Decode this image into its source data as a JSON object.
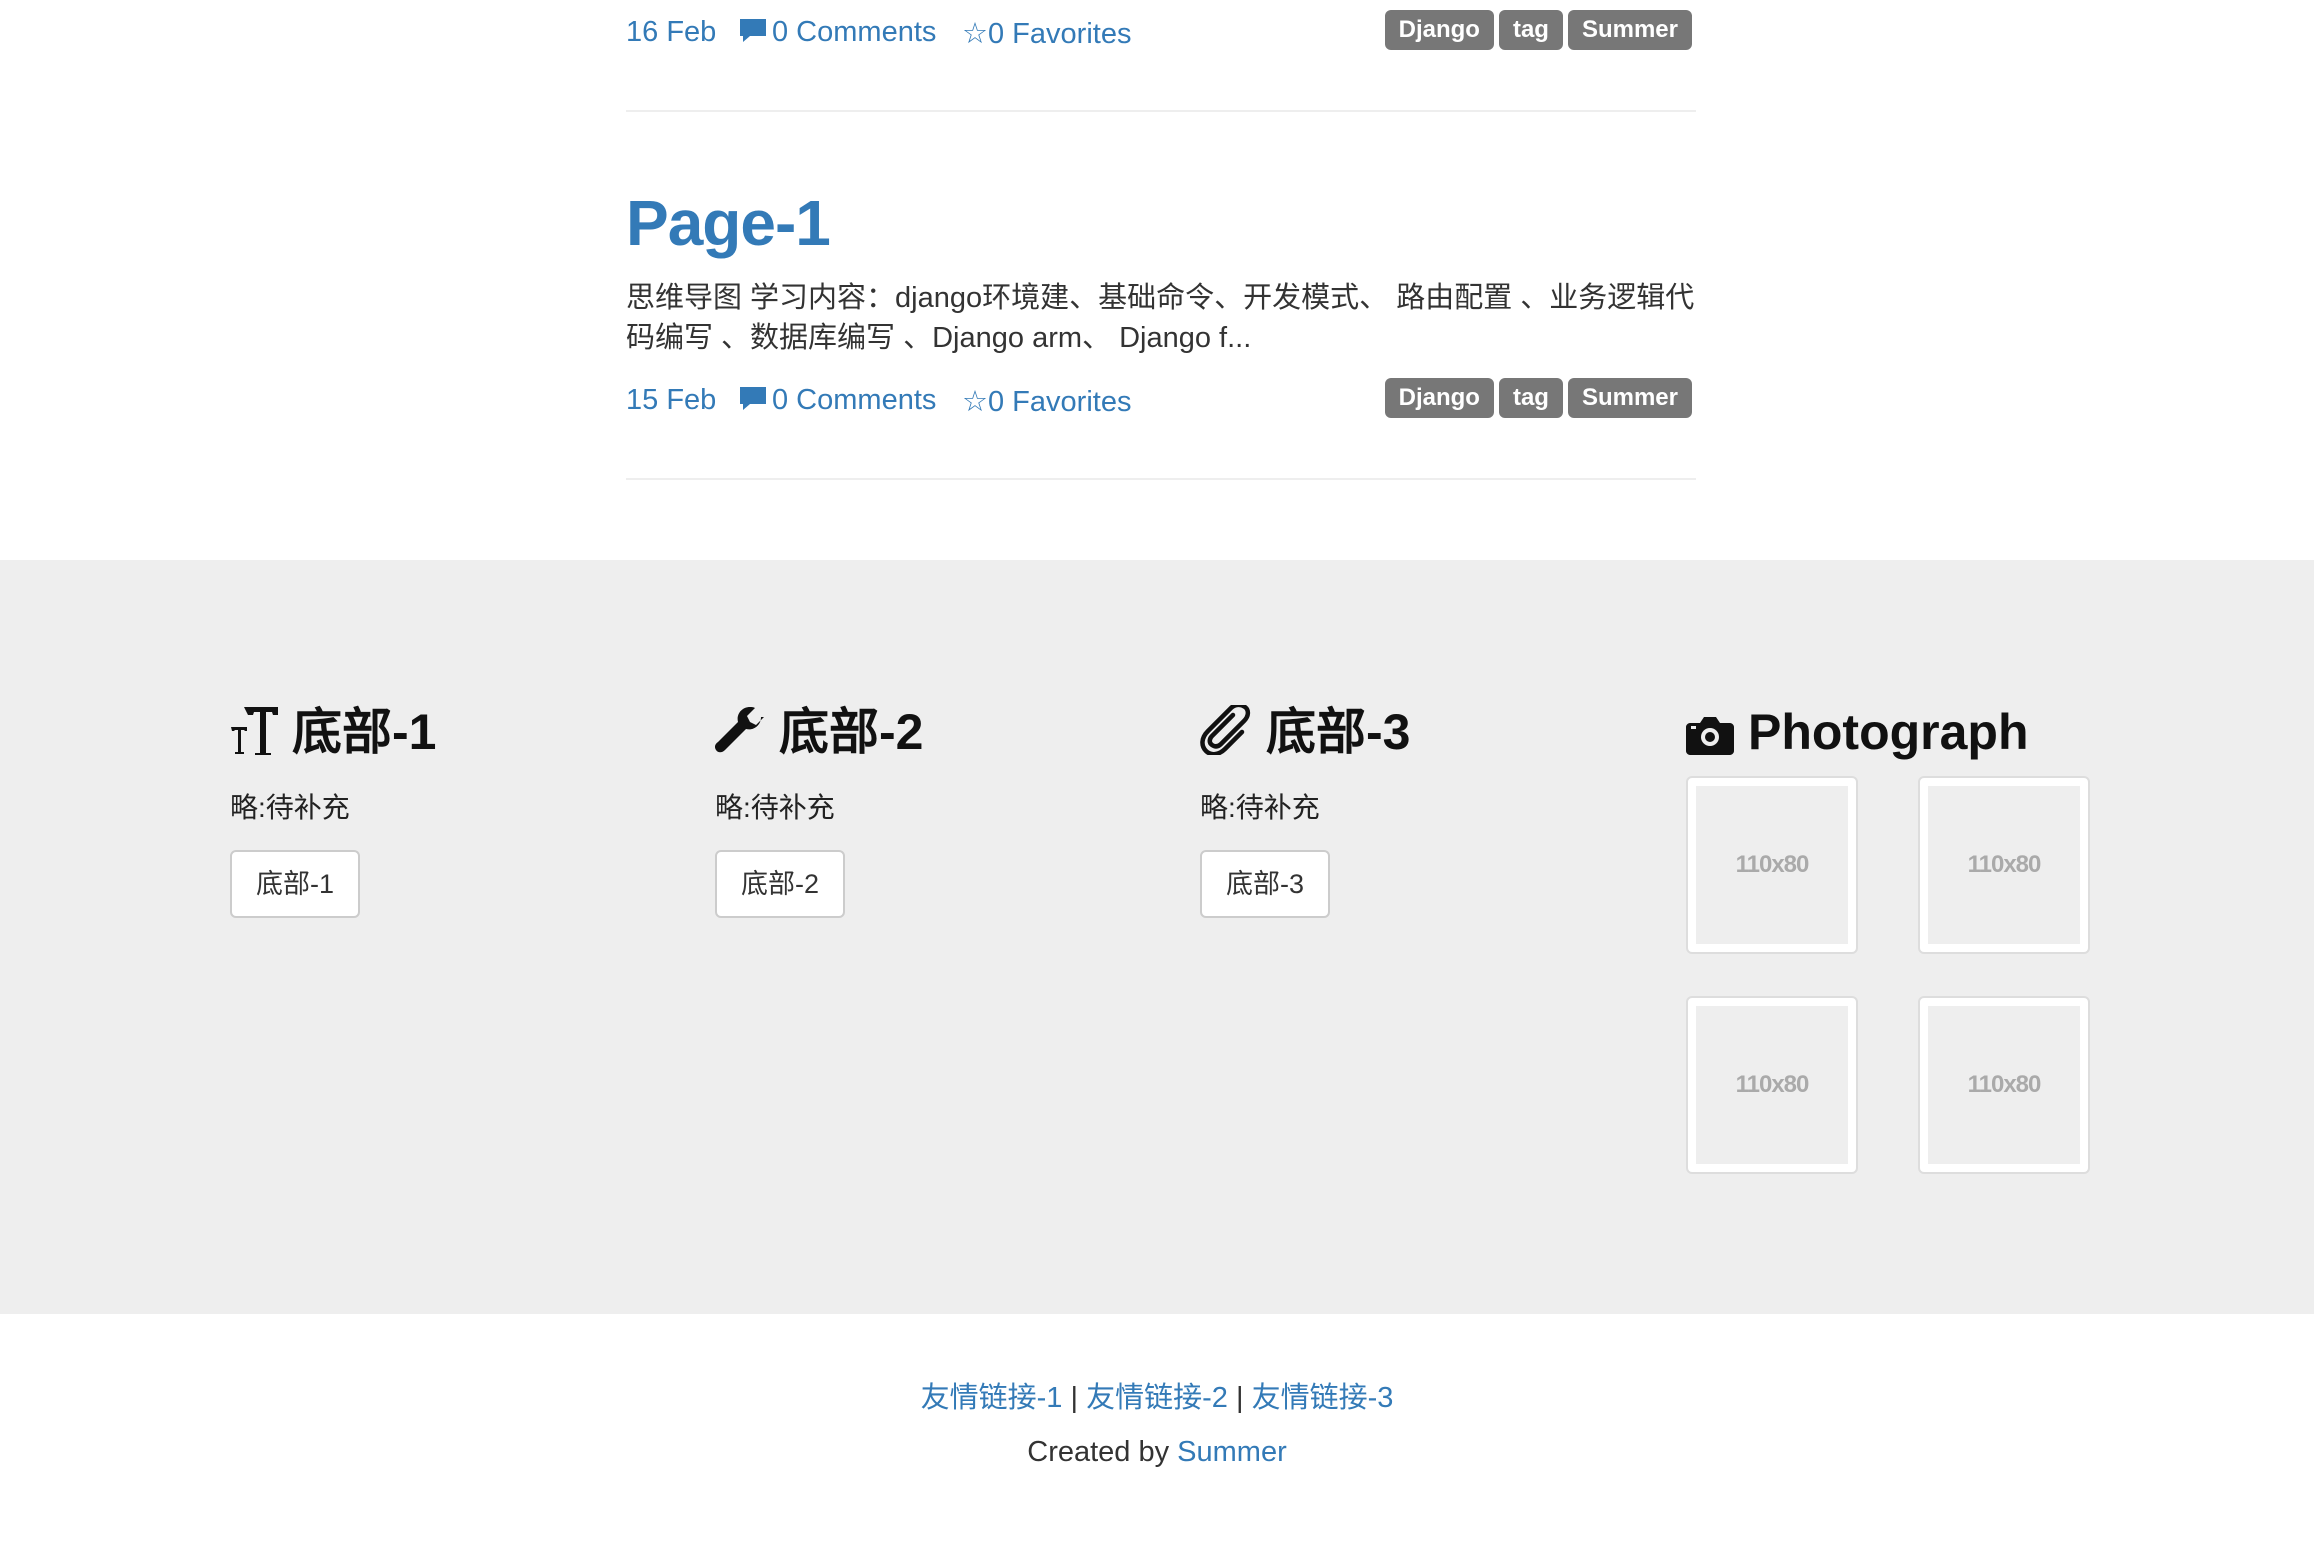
{
  "posts": [
    {
      "title": "",
      "date": "16 Feb",
      "comments": "0 Comments",
      "favorites": "0 Favorites",
      "tags": [
        "Django",
        "tag",
        "Summer"
      ]
    },
    {
      "title": "Page-1",
      "excerpt": "思维导图 学习内容：django环境建、基础命令、开发模式、 路由配置 、业务逻辑代码编写 、数据库编写 、Django arm、 Django f...",
      "date": "15 Feb",
      "comments": "0 Comments",
      "favorites": "0 Favorites",
      "tags": [
        "Django",
        "tag",
        "Summer"
      ]
    }
  ],
  "footer": {
    "columns": [
      {
        "icon": "text-height-icon",
        "title": "底部-1",
        "text": "略:待补充",
        "button": "底部-1"
      },
      {
        "icon": "wrench-icon",
        "title": "底部-2",
        "text": "略:待补充",
        "button": "底部-2"
      },
      {
        "icon": "paperclip-icon",
        "title": "底部-3",
        "text": "略:待补充",
        "button": "底部-3"
      }
    ],
    "photograph": {
      "icon": "camera-icon",
      "title": "Photograph",
      "thumbs": [
        "110x80",
        "110x80",
        "110x80",
        "110x80"
      ]
    }
  },
  "bottom": {
    "links": [
      "友情链接-1",
      "友情链接-2",
      "友情链接-3"
    ],
    "separator": "|",
    "created_by": "Created by",
    "author": "Summer"
  },
  "colors": {
    "link": "#337ab7",
    "tag_bg": "#777777",
    "footer_bg": "#eeeeee"
  }
}
